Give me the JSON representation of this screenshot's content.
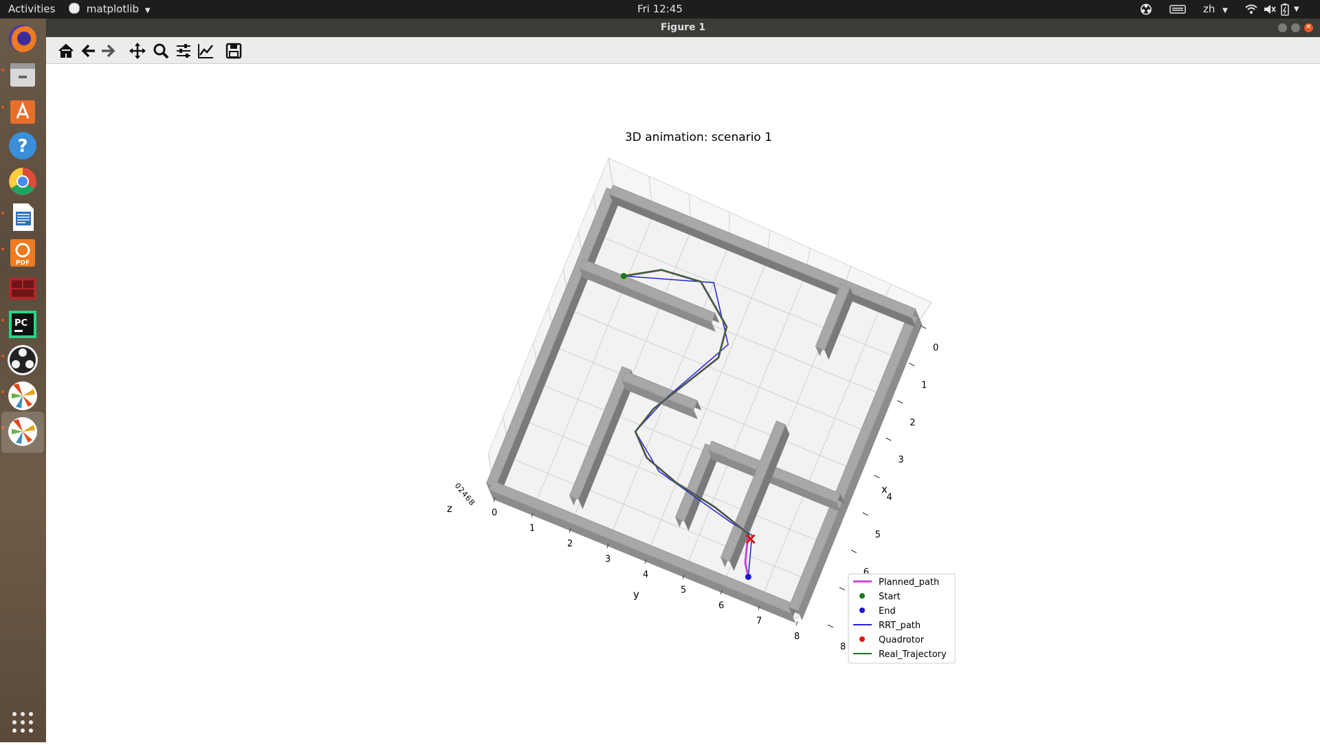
{
  "topbar": {
    "activities": "Activities",
    "app_name": "matplotlib",
    "clock": "Fri 12:45",
    "language": "zh"
  },
  "dock": {
    "apps": [
      {
        "name": "firefox-icon",
        "color": "#e8712a"
      },
      {
        "name": "files-icon",
        "color": "#8a8a8a"
      },
      {
        "name": "software-center-icon",
        "color": "#e96e2b"
      },
      {
        "name": "help-icon",
        "color": "#3b8fd8"
      },
      {
        "name": "chrome-icon",
        "color": "#dd4b39"
      },
      {
        "name": "writer-icon",
        "color": "#2a6fbf"
      },
      {
        "name": "pdf-editor-icon",
        "color": "#f07a1c"
      },
      {
        "name": "terminal-icon",
        "color": "#b2262b"
      },
      {
        "name": "pycharm-icon",
        "color": "#1a1a1a"
      },
      {
        "name": "obs-icon",
        "color": "#2b2b2b"
      },
      {
        "name": "matplotlib-icon-1",
        "color": "#ffffff"
      },
      {
        "name": "matplotlib-icon-2",
        "color": "#ffffff"
      }
    ],
    "show_apps_icon": "grid-icon"
  },
  "window": {
    "title": "Figure 1"
  },
  "toolbar": {
    "buttons": [
      "home-icon",
      "back-icon",
      "forward-icon",
      "pan-icon",
      "zoom-icon",
      "configure-subplots-icon",
      "edit-axis-icon",
      "save-icon"
    ]
  },
  "chart_data": {
    "type": "line",
    "title": "3D animation: scenario 1",
    "xlabel": "x",
    "ylabel": "y",
    "zlabel": "z",
    "xlim": [
      0,
      8
    ],
    "ylim": [
      0,
      8
    ],
    "x_ticks": [
      "0",
      "1",
      "2",
      "3",
      "4",
      "5",
      "6",
      "7",
      "8"
    ],
    "y_ticks": [
      "0",
      "1",
      "2",
      "3",
      "4",
      "5",
      "6",
      "7",
      "8"
    ],
    "z_ticks": [
      "0",
      "2",
      "4",
      "6",
      "8"
    ],
    "grid": true,
    "legend_position": "bottom-right",
    "legend": [
      {
        "label": "Planned_path",
        "kind": "line",
        "color": "#cc44cc"
      },
      {
        "label": "Start",
        "kind": "dot",
        "color": "#1a7a1a"
      },
      {
        "label": "End",
        "kind": "dot",
        "color": "#1515d6"
      },
      {
        "label": "RRT_path",
        "kind": "line",
        "color": "#2020d8"
      },
      {
        "label": "Quadrotor",
        "kind": "dot",
        "color": "#e01010"
      },
      {
        "label": "Real_Trajectory",
        "kind": "line",
        "color": "#1e6e1e"
      }
    ],
    "series": [
      {
        "name": "Start",
        "points": [
          [
            0.9,
            1.7
          ]
        ]
      },
      {
        "name": "End",
        "points": [
          [
            6.5,
            7.5
          ]
        ]
      },
      {
        "name": "Quadrotor",
        "points": [
          [
            6.2,
            6.6
          ]
        ]
      },
      {
        "name": "RRT_path",
        "points": [
          [
            0.9,
            1.7
          ],
          [
            3.0,
            1.0
          ],
          [
            3.9,
            2.3
          ],
          [
            3.0,
            4.1
          ],
          [
            2.6,
            5.2
          ],
          [
            3.5,
            5.9
          ],
          [
            5.6,
            6.4
          ],
          [
            6.2,
            6.5
          ],
          [
            6.5,
            7.5
          ]
        ]
      },
      {
        "name": "Planned_path",
        "points": [
          [
            0.9,
            1.7
          ],
          [
            1.7,
            1.2
          ],
          [
            2.7,
            1.1
          ],
          [
            3.7,
            1.9
          ],
          [
            3.8,
            2.7
          ],
          [
            3.3,
            3.6
          ],
          [
            2.8,
            4.5
          ],
          [
            2.6,
            5.2
          ],
          [
            3.1,
            5.7
          ],
          [
            4.0,
            6.0
          ],
          [
            5.1,
            6.2
          ],
          [
            6.1,
            6.5
          ],
          [
            6.3,
            7.2
          ],
          [
            6.5,
            7.5
          ]
        ]
      },
      {
        "name": "Real_Trajectory",
        "points": [
          [
            0.9,
            1.7
          ],
          [
            1.7,
            1.2
          ],
          [
            2.7,
            1.1
          ],
          [
            3.7,
            1.9
          ],
          [
            3.8,
            2.7
          ],
          [
            3.3,
            3.6
          ],
          [
            2.8,
            4.5
          ],
          [
            2.6,
            5.2
          ],
          [
            3.1,
            5.7
          ],
          [
            4.0,
            6.0
          ],
          [
            5.1,
            6.2
          ],
          [
            6.1,
            6.5
          ],
          [
            6.2,
            6.6
          ]
        ]
      }
    ],
    "walls": [
      {
        "from": [
          0,
          0
        ],
        "to": [
          0,
          8
        ]
      },
      {
        "from": [
          0,
          8
        ],
        "to": [
          8,
          8
        ]
      },
      {
        "from": [
          8,
          8
        ],
        "to": [
          8,
          0
        ]
      },
      {
        "from": [
          8,
          0
        ],
        "to": [
          0,
          0
        ]
      },
      {
        "from": [
          0,
          2
        ],
        "to": [
          3.5,
          2
        ]
      },
      {
        "from": [
          6.2,
          0
        ],
        "to": [
          6.2,
          1.7
        ]
      },
      {
        "from": [
          2.0,
          4.0
        ],
        "to": [
          2.0,
          7.5
        ]
      },
      {
        "from": [
          2.0,
          4.2
        ],
        "to": [
          3.9,
          4.2
        ]
      },
      {
        "from": [
          4.6,
          5.0
        ],
        "to": [
          4.6,
          7.0
        ]
      },
      {
        "from": [
          4.6,
          5.0
        ],
        "to": [
          8.0,
          5.0
        ]
      },
      {
        "from": [
          6.0,
          3.8
        ],
        "to": [
          6.0,
          7.5
        ]
      }
    ]
  }
}
